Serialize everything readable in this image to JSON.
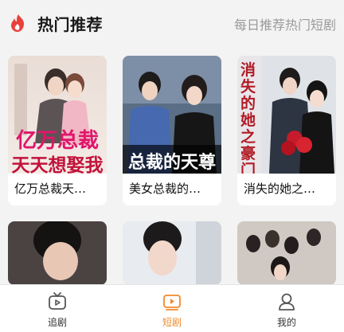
{
  "header": {
    "title": "热门推荐",
    "more_label": "每日推荐热门短剧",
    "icon": "flame-icon"
  },
  "dramas": [
    {
      "title": "亿万总裁天…",
      "cover_text_1": "亿万总裁",
      "cover_text_2": "天天想娶我"
    },
    {
      "title": "美女总裁的…",
      "cover_text_1": "总裁的天尊"
    },
    {
      "title": "消失的她之…",
      "cover_text_1": "消失的她之豪门千"
    },
    {
      "title": ""
    },
    {
      "title": ""
    },
    {
      "title": ""
    }
  ],
  "tabbar": {
    "items": [
      {
        "label": "追剧",
        "icon": "tv-icon",
        "active": false
      },
      {
        "label": "短剧",
        "icon": "play-icon",
        "active": true
      },
      {
        "label": "我的",
        "icon": "user-icon",
        "active": false
      }
    ],
    "active_color": "#f08b2a"
  },
  "colors": {
    "accent": "#e8413a",
    "tab_active": "#f08b2a",
    "muted": "#9a9a9a",
    "background": "#f3f3f3"
  }
}
